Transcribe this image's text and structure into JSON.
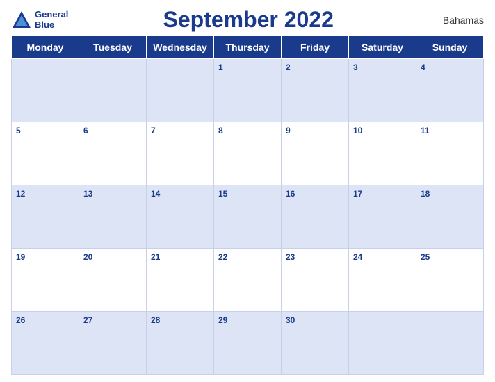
{
  "header": {
    "logo_line1": "General",
    "logo_line2": "Blue",
    "title": "September 2022",
    "country": "Bahamas"
  },
  "weekdays": [
    "Monday",
    "Tuesday",
    "Wednesday",
    "Thursday",
    "Friday",
    "Saturday",
    "Sunday"
  ],
  "weeks": [
    [
      null,
      null,
      null,
      1,
      2,
      3,
      4
    ],
    [
      5,
      6,
      7,
      8,
      9,
      10,
      11
    ],
    [
      12,
      13,
      14,
      15,
      16,
      17,
      18
    ],
    [
      19,
      20,
      21,
      22,
      23,
      24,
      25
    ],
    [
      26,
      27,
      28,
      29,
      30,
      null,
      null
    ]
  ]
}
